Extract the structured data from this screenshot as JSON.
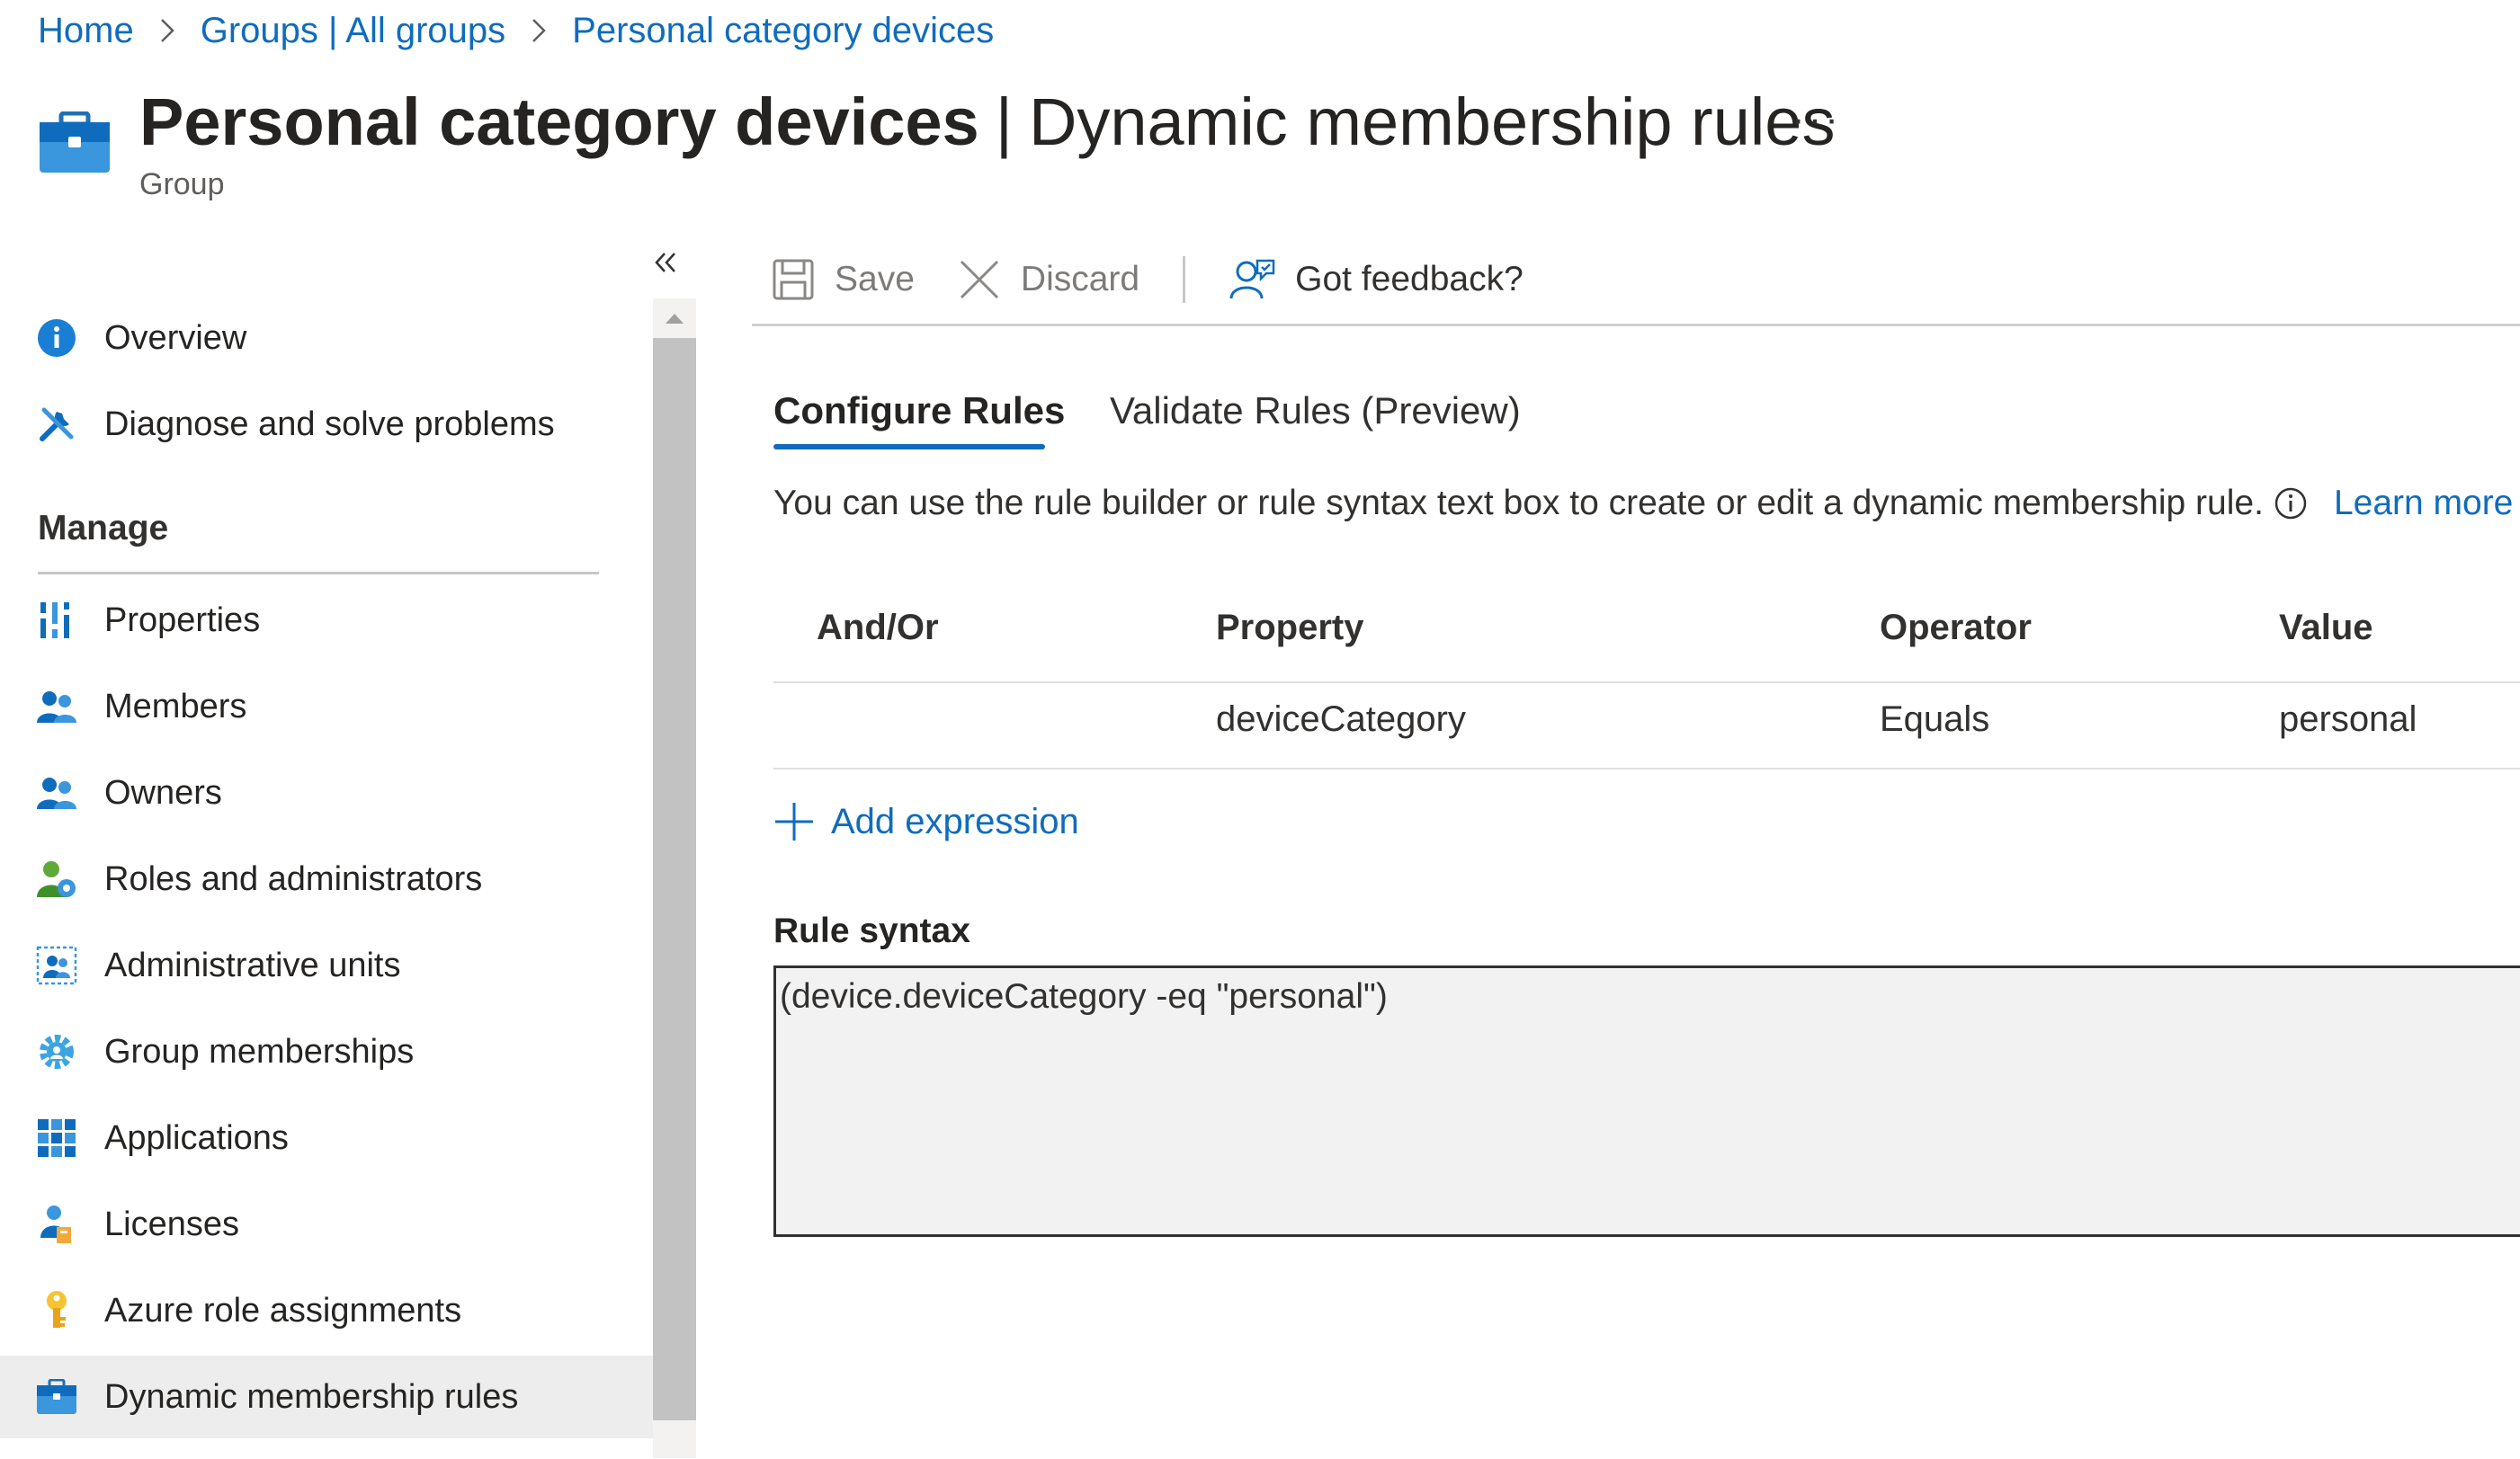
{
  "breadcrumb": [
    {
      "label": "Home"
    },
    {
      "label": "Groups | All groups"
    },
    {
      "label": "Personal category devices"
    }
  ],
  "header": {
    "title_bold": "Personal category devices",
    "title_rest": "Dynamic membership rules",
    "subtitle": "Group",
    "more": "···"
  },
  "sidebar": {
    "items_top": [
      {
        "label": "Overview",
        "icon": "info-icon"
      },
      {
        "label": "Diagnose and solve problems",
        "icon": "wrench-icon"
      }
    ],
    "section": "Manage",
    "items_manage": [
      {
        "label": "Properties",
        "icon": "properties-icon"
      },
      {
        "label": "Members",
        "icon": "members-icon"
      },
      {
        "label": "Owners",
        "icon": "owners-icon"
      },
      {
        "label": "Roles and administrators",
        "icon": "roles-icon"
      },
      {
        "label": "Administrative units",
        "icon": "admin-units-icon"
      },
      {
        "label": "Group memberships",
        "icon": "gear-icon"
      },
      {
        "label": "Applications",
        "icon": "grid-icon"
      },
      {
        "label": "Licenses",
        "icon": "licenses-icon"
      },
      {
        "label": "Azure role assignments",
        "icon": "key-icon"
      },
      {
        "label": "Dynamic membership rules",
        "icon": "toolbox-icon",
        "active": true
      }
    ]
  },
  "toolbar": {
    "save": "Save",
    "discard": "Discard",
    "feedback": "Got feedback?"
  },
  "tabs": [
    {
      "label": "Configure Rules",
      "active": true
    },
    {
      "label": "Validate Rules (Preview)",
      "active": false
    }
  ],
  "description": {
    "text": "You can use the rule builder or rule syntax text box to create or edit a dynamic membership rule.",
    "link": "Learn more"
  },
  "rules_table": {
    "headers": [
      "And/Or",
      "Property",
      "Operator",
      "Value"
    ],
    "rows": [
      {
        "and_or": "",
        "property": "deviceCategory",
        "operator": "Equals",
        "value": "personal"
      }
    ]
  },
  "add_expression": "Add expression",
  "rule_syntax": {
    "label": "Rule syntax",
    "value": "(device.deviceCategory -eq \"personal\")"
  },
  "colors": {
    "accent": "#0f6cbd",
    "active_nav_bg": "#ededed",
    "syntax_bg": "#f2f2f2"
  }
}
